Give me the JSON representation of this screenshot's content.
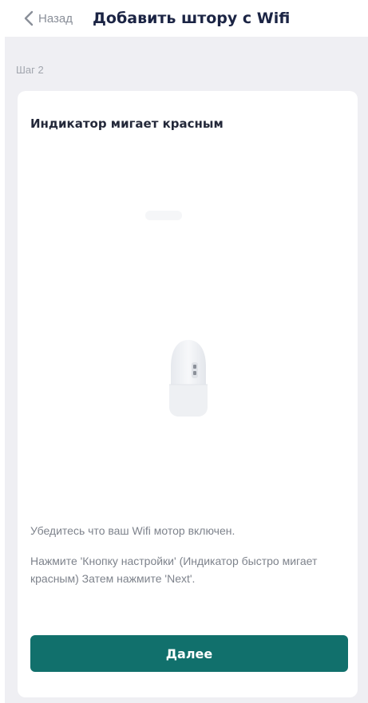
{
  "header": {
    "back_label": "Назад",
    "title": "Добавить штору с Wifi"
  },
  "step_label": "Шаг 2",
  "card": {
    "title": "Индикатор мигает красным",
    "instructions": [
      "Убедитесь что ваш Wifi мотор включен.",
      "Нажмите 'Кнопку настройки' (Индикатор быстро мигает красным) Затем нажмите 'Next'."
    ],
    "next_button_label": "Далее"
  },
  "colors": {
    "accent": "#11706c",
    "background": "#efeff3",
    "title_text": "#1b2444"
  },
  "icons": {
    "back": "chevron-left-icon",
    "device": "wifi-motor-device-icon"
  }
}
